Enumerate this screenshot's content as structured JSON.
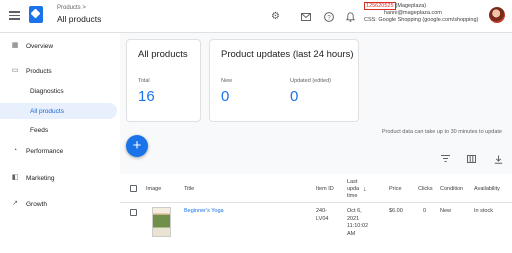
{
  "header": {
    "breadcrumb": "Products >",
    "title": "All products",
    "account_id": "125620525",
    "account_name": "(Mageplaza)",
    "account_email": "hanni@mageplaza.com",
    "css_label": "CSS: Google Shopping (google.com/shopping)",
    "icons": [
      "settings-icon",
      "mail-icon",
      "help-icon",
      "notifications-icon"
    ]
  },
  "sidebar": {
    "items": [
      {
        "label": "Overview",
        "icon": "overview-icon"
      },
      {
        "label": "Products",
        "icon": "products-icon"
      },
      {
        "label": "Diagnostics"
      },
      {
        "label": "All products"
      },
      {
        "label": "Feeds"
      },
      {
        "label": "Performance",
        "icon": "performance-icon"
      },
      {
        "label": "Marketing",
        "icon": "marketing-icon"
      },
      {
        "label": "Growth",
        "icon": "growth-icon"
      }
    ]
  },
  "cards": {
    "all_products": {
      "title": "All products",
      "stat_label": "Total",
      "stat_value": "16"
    },
    "updates": {
      "title": "Product updates (last 24 hours)",
      "stats": [
        {
          "label": "New",
          "value": "0"
        },
        {
          "label": "Updated (edited)",
          "value": "0"
        }
      ]
    }
  },
  "note": "Product data can take up to 30 minutes to update",
  "table": {
    "columns": {
      "image": "Image",
      "title": "Title",
      "item_id": "Item ID",
      "last_update": [
        "Last",
        "upda",
        "time"
      ],
      "price": "Price",
      "clicks": "Clicks",
      "condition": "Condition",
      "availability": "Availability"
    },
    "rows": [
      {
        "title": "Beginner's Yoga",
        "item_id": [
          "240-",
          "LV04"
        ],
        "last_update": [
          "Oct 6,",
          "2021",
          "11:10:02",
          "AM"
        ],
        "price": "$6.00",
        "clicks": "0",
        "condition": "New",
        "availability": "In stock"
      }
    ]
  },
  "colors": {
    "accent": "#1a73e8",
    "highlight": "#d93025"
  }
}
